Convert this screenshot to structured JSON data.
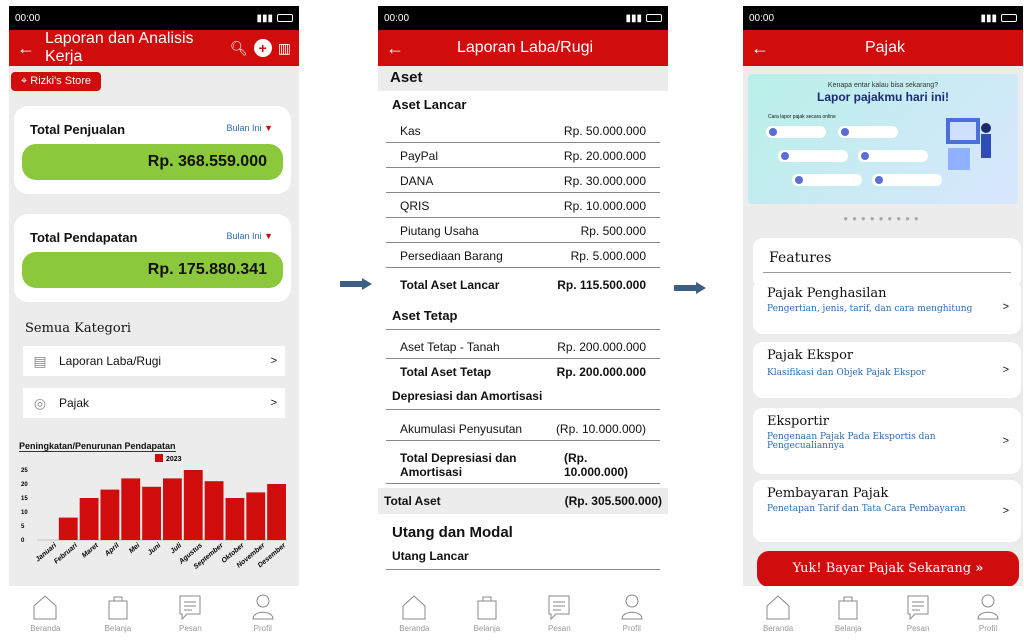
{
  "screen1": {
    "status_time": "00:00",
    "title": "Laporan dan Analisis Kerja",
    "store": "Rizki's Store",
    "sales": {
      "label": "Total Penjualan",
      "period": "Bulan Ini",
      "value": "Rp. 368.559.000"
    },
    "income": {
      "label": "Total Pendapatan",
      "period": "Bulan Ini",
      "value": "Rp. 175.880.341"
    },
    "category_heading": "Semua Kategori",
    "categories": [
      {
        "label": "Laporan Laba/Rugi"
      },
      {
        "label": "Pajak"
      }
    ]
  },
  "chart_data": {
    "type": "bar",
    "title": "Peningkatan/Penurunan Pendapatan",
    "legend": "2023",
    "categories": [
      "Januari",
      "Februari",
      "Maret",
      "April",
      "Mei",
      "Juni",
      "Juli",
      "Agustus",
      "September",
      "Oktober",
      "November",
      "Desember"
    ],
    "values": [
      0,
      8,
      15,
      18,
      22,
      19,
      22,
      25,
      21,
      15,
      17,
      20
    ],
    "ylim": [
      0,
      25
    ],
    "yticks": [
      "25",
      "20",
      "15",
      "10",
      "5",
      "0"
    ],
    "color": "#d10c0c"
  },
  "screen2": {
    "status_time": "00:00",
    "title": "Laporan Laba/Rugi",
    "aset": "Aset",
    "aset_lancar": "Aset Lancar",
    "lancar_rows": [
      {
        "k": "Kas",
        "v": "Rp. 50.000.000"
      },
      {
        "k": "PayPal",
        "v": "Rp. 20.000.000"
      },
      {
        "k": "DANA",
        "v": "Rp. 30.000.000"
      },
      {
        "k": "QRIS",
        "v": "Rp. 10.000.000"
      },
      {
        "k": "Piutang Usaha",
        "v": "Rp. 500.000"
      },
      {
        "k": "Persediaan Barang",
        "v": "Rp. 5.000.000"
      }
    ],
    "total_lancar": {
      "k": "Total Aset Lancar",
      "v": "Rp. 115.500.000"
    },
    "aset_tetap": "Aset Tetap",
    "tetap_row": {
      "k": "Aset Tetap - Tanah",
      "v": "Rp. 200.000.000"
    },
    "total_tetap": {
      "k": "Total Aset Tetap",
      "v": "Rp. 200.000.000"
    },
    "depresiasi": "Depresiasi dan Amortisasi",
    "akumulasi": {
      "k": "Akumulasi Penyusutan",
      "v": "(Rp. 10.000.000)"
    },
    "total_depresiasi": {
      "k": "Total Depresiasi dan Amortisasi",
      "v": "(Rp. 10.000.000)"
    },
    "total_aset": {
      "k": "Total Aset",
      "v": "(Rp. 305.500.000)"
    },
    "utang": "Utang dan Modal",
    "utang_lancar": "Utang Lancar"
  },
  "screen3": {
    "status_time": "00:00",
    "title": "Pajak",
    "banner_sub": "Kenapa entar kalau bisa sekarang?",
    "banner_head": "Lapor pajakmu hari ini!",
    "banner_small": "Cara lapor pajak secara online",
    "features_heading": "Features",
    "items": [
      {
        "t": "Pajak Penghasilan",
        "d": "Pengertian, jenis, tarif, dan cara menghitung"
      },
      {
        "t": "Pajak Ekspor",
        "d": "Klasifikasi dan Objek Pajak Ekspor"
      },
      {
        "t": "Eksportir",
        "d": "Pengenaan Pajak Pada Eksportis dan Pengecualiannya"
      },
      {
        "t": "Pembayaran Pajak",
        "d": "Penetapan Tarif dan Tata Cara Pembayaran"
      }
    ],
    "pay_button": "Yuk! Bayar Pajak Sekarang"
  },
  "nav": [
    "Beranda",
    "Belanja",
    "Pesan",
    "Profil"
  ],
  "colors": {
    "brand": "#d10c0c",
    "value_bg": "#8bc83c",
    "arrow": "#3d5f82"
  }
}
